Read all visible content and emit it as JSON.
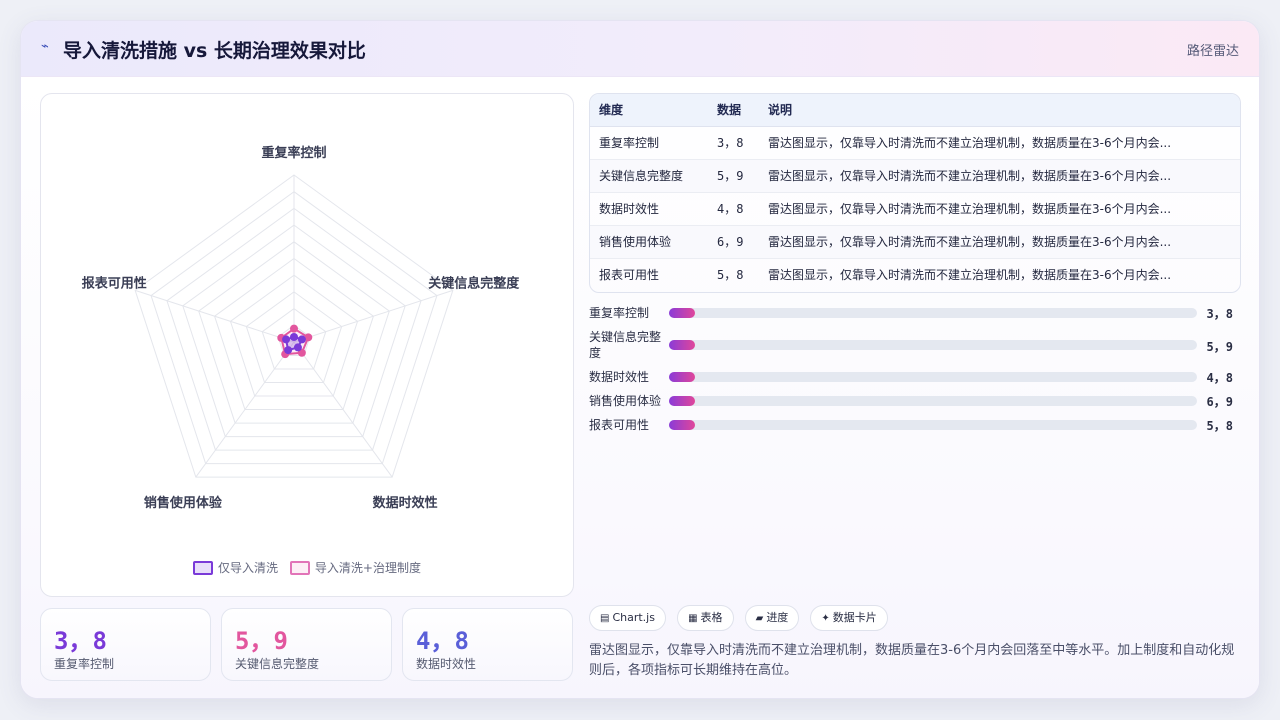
{
  "header": {
    "logo_icon": "pulse-icon",
    "logo_glyph": "⌁",
    "title": "导入清洗措施 vs 长期治理效果对比",
    "tag": "路径雷达"
  },
  "chart_data": {
    "type": "radar",
    "axes": [
      "重复率控制",
      "关键信息完整度",
      "数据时效性",
      "销售使用体验",
      "报表可用性"
    ],
    "series": [
      {
        "name": "仅导入清洗",
        "values": [
          3,
          5,
          4,
          6,
          5
        ],
        "color": "#7a3ad8"
      },
      {
        "name": "导入清洗+治理制度",
        "values": [
          8,
          9,
          8,
          9,
          8
        ],
        "color": "#e2569e"
      }
    ],
    "grid_levels": 10,
    "rmax": 100
  },
  "legend": {
    "items": [
      {
        "label": "仅导入清洗"
      },
      {
        "label": "导入清洗+治理制度"
      }
    ]
  },
  "stats": [
    {
      "value": "3，8",
      "label": "重复率控制",
      "color": "#7a3ad8"
    },
    {
      "value": "5，9",
      "label": "关键信息完整度",
      "color": "#e2569e"
    },
    {
      "value": "4，8",
      "label": "数据时效性",
      "color": "#5a5fd8"
    }
  ],
  "table": {
    "headers": [
      "维度",
      "数据",
      "说明"
    ],
    "rows": [
      [
        "重复率控制",
        "3，8",
        "雷达图显示，仅靠导入时清洗而不建立治理机制，数据质量在3-6个月内会..."
      ],
      [
        "关键信息完整度",
        "5，9",
        "雷达图显示，仅靠导入时清洗而不建立治理机制，数据质量在3-6个月内会..."
      ],
      [
        "数据时效性",
        "4，8",
        "雷达图显示，仅靠导入时清洗而不建立治理机制，数据质量在3-6个月内会..."
      ],
      [
        "销售使用体验",
        "6，9",
        "雷达图显示，仅靠导入时清洗而不建立治理机制，数据质量在3-6个月内会..."
      ],
      [
        "报表可用性",
        "5，8",
        "雷达图显示，仅靠导入时清洗而不建立治理机制，数据质量在3-6个月内会..."
      ]
    ]
  },
  "progress": [
    {
      "label": "重复率控制",
      "value": "3，8",
      "fraction": 0.05
    },
    {
      "label": "关键信息完整度",
      "value": "5，9",
      "fraction": 0.05
    },
    {
      "label": "数据时效性",
      "value": "4，8",
      "fraction": 0.05
    },
    {
      "label": "销售使用体验",
      "value": "6，9",
      "fraction": 0.05
    },
    {
      "label": "报表可用性",
      "value": "5，8",
      "fraction": 0.05
    }
  ],
  "chips": [
    {
      "icon": "chart-icon",
      "glyph": "▤",
      "label": "Chart.js"
    },
    {
      "icon": "table-icon",
      "glyph": "▦",
      "label": "表格"
    },
    {
      "icon": "progress-icon",
      "glyph": "▰",
      "label": "进度"
    },
    {
      "icon": "card-icon",
      "glyph": "✦",
      "label": "数据卡片"
    }
  ],
  "description": "雷达图显示，仅靠导入时清洗而不建立治理机制，数据质量在3-6个月内会回落至中等水平。加上制度和自动化规则后，各项指标可长期维持在高位。"
}
